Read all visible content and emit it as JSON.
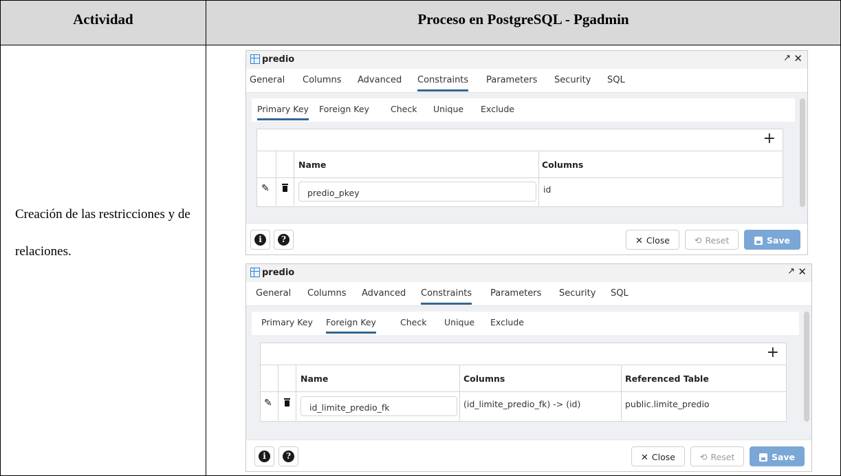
{
  "table": {
    "header_activity": "Actividad",
    "header_process": "Proceso en PostgreSQL - Pgadmin",
    "activity_text": "Creación de las restricciones y de relaciones."
  },
  "dialog1": {
    "title": "predio",
    "tabs": [
      "General",
      "Columns",
      "Advanced",
      "Constraints",
      "Parameters",
      "Security",
      "SQL"
    ],
    "subtabs": [
      "Primary Key",
      "Foreign Key",
      "Check",
      "Unique",
      "Exclude"
    ],
    "col_name": "Name",
    "col_columns": "Columns",
    "row_name": "predio_pkey",
    "row_columns": "id",
    "close": "Close",
    "reset": "Reset",
    "save": "Save"
  },
  "dialog2": {
    "title": "predio",
    "tabs": [
      "General",
      "Columns",
      "Advanced",
      "Constraints",
      "Parameters",
      "Security",
      "SQL"
    ],
    "subtabs": [
      "Primary Key",
      "Foreign Key",
      "Check",
      "Unique",
      "Exclude"
    ],
    "col_name": "Name",
    "col_columns": "Columns",
    "col_ref": "Referenced Table",
    "row_name": "id_limite_predio_fk",
    "row_columns": "(id_limite_predio_fk) -> (id)",
    "row_ref": "public.limite_predio",
    "close": "Close",
    "reset": "Reset",
    "save": "Save"
  },
  "icons": {
    "add": "plus-icon",
    "edit": "pencil-icon",
    "delete": "trash-icon",
    "info": "info-icon",
    "help": "help-icon",
    "close": "close-icon",
    "reset": "reset-icon",
    "save": "save-icon",
    "expand": "expand-icon",
    "table": "table-icon"
  },
  "colors": {
    "accent": "#326690",
    "save_button": "#7aa7d6",
    "header_bg": "#d9d9d9"
  }
}
